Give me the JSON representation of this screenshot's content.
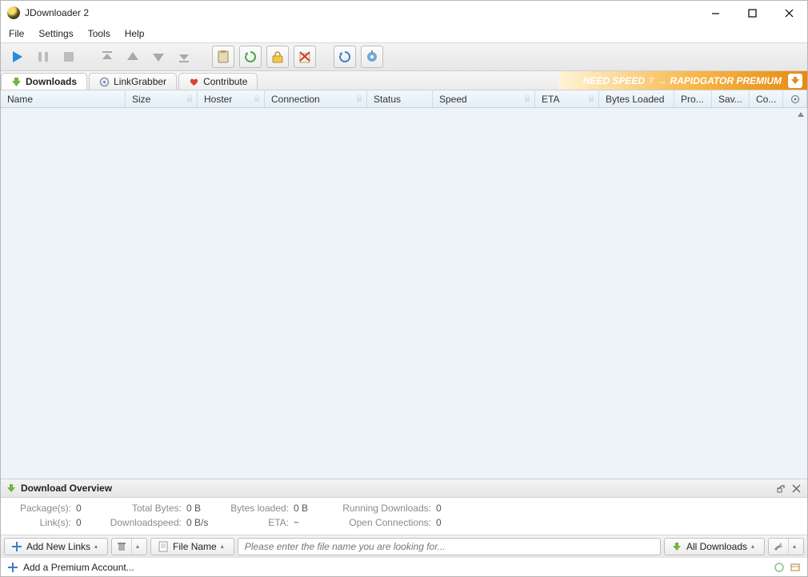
{
  "window": {
    "title": "JDownloader 2"
  },
  "menu": {
    "file": "File",
    "settings": "Settings",
    "tools": "Tools",
    "help": "Help"
  },
  "tabs": {
    "downloads": "Downloads",
    "linkgrabber": "LinkGrabber",
    "contribute": "Contribute"
  },
  "promo": {
    "need": "NEED SPEED",
    "q": "?",
    "arrow": "→",
    "brand": "RAPIDGATOR PREMIUM"
  },
  "columns": {
    "name": "Name",
    "size": "Size",
    "hoster": "Hoster",
    "connection": "Connection",
    "status": "Status",
    "speed": "Speed",
    "eta": "ETA",
    "bytes": "Bytes Loaded",
    "pro": "Pro...",
    "sav": "Sav...",
    "co": "Co..."
  },
  "panel": {
    "title": "Download Overview"
  },
  "overview": {
    "packages_label": "Package(s):",
    "packages_value": "0",
    "links_label": "Link(s):",
    "links_value": "0",
    "totalbytes_label": "Total Bytes:",
    "totalbytes_value": "0 B",
    "dlspeed_label": "Downloadspeed:",
    "dlspeed_value": "0 B/s",
    "bytesloaded_label": "Bytes loaded:",
    "bytesloaded_value": "0 B",
    "eta_label": "ETA:",
    "eta_value": "~",
    "running_label": "Running Downloads:",
    "running_value": "0",
    "openconn_label": "Open Connections:",
    "openconn_value": "0"
  },
  "buttons": {
    "addlinks": "Add New Links",
    "filename": "File Name",
    "alldl": "All Downloads"
  },
  "search": {
    "placeholder": "Please enter the file name you are looking for..."
  },
  "status": {
    "addpremium": "Add a Premium Account..."
  }
}
